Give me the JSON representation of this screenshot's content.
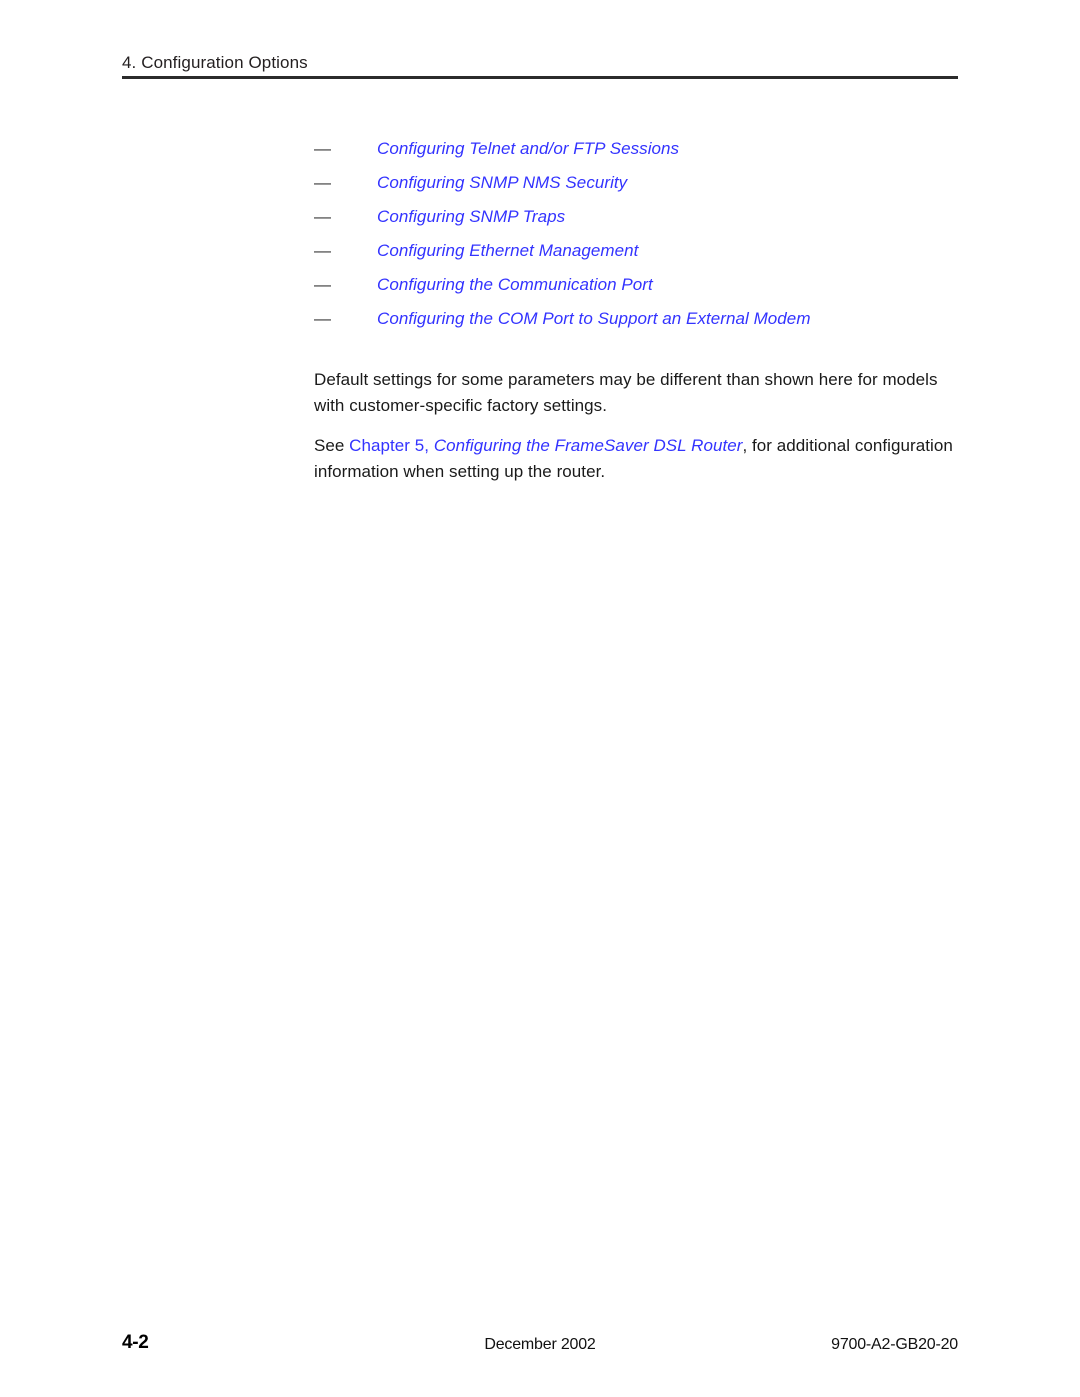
{
  "header": {
    "chapter_label": "4. Configuration Options"
  },
  "link_list": {
    "bullet": "—",
    "items": [
      {
        "label": "Configuring Telnet and/or FTP Sessions"
      },
      {
        "label": "Configuring SNMP NMS Security"
      },
      {
        "label": "Configuring SNMP Traps"
      },
      {
        "label": "Configuring Ethernet Management"
      },
      {
        "label": "Configuring the Communication Port"
      },
      {
        "label": "Configuring the COM Port to Support an External Modem"
      }
    ]
  },
  "body": {
    "paragraph_1": "Default settings for some parameters may be different than shown here for models with customer-specific factory settings.",
    "paragraph_2": {
      "lead_text": "See ",
      "xref_roman": "Chapter 5, ",
      "xref_italic": "Configuring the FrameSaver DSL Router",
      "trailing_text": ", for additional configuration information when setting up the router."
    }
  },
  "footer": {
    "page_number": "4-2",
    "date": "December 2002",
    "document_number": "9700-A2-GB20-20"
  },
  "colors": {
    "link_blue": "#3333FF",
    "body_black": "#1A1A1A",
    "rule_gray": "#2B2B2B"
  }
}
